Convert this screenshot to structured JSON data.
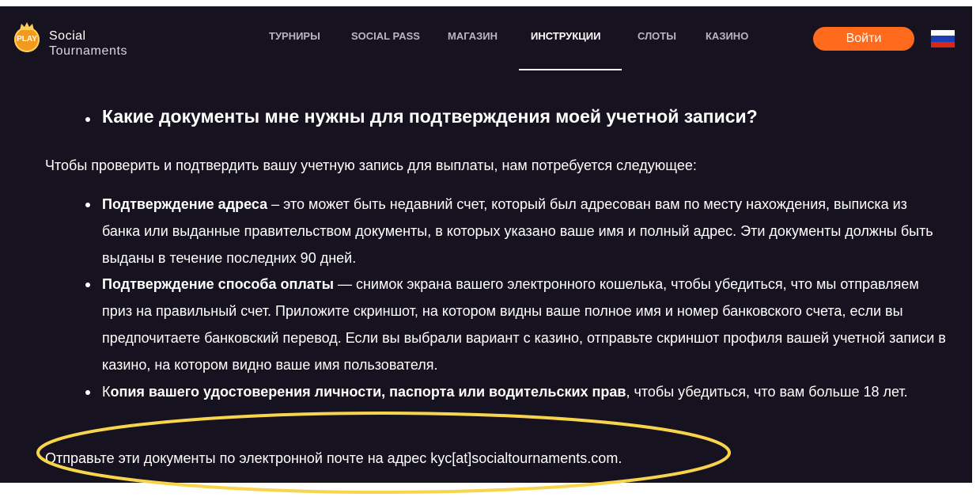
{
  "header": {
    "logo": {
      "badge": "PLAY",
      "line1": "Social",
      "line2": "Tournaments"
    },
    "nav": [
      {
        "label": "ТУРНИРЫ",
        "active": false
      },
      {
        "label": "SOCIAL PASS",
        "active": false
      },
      {
        "label": "МАГАЗИН",
        "active": false
      },
      {
        "label": "ИНСТРУКЦИИ",
        "active": true
      },
      {
        "label": "СЛОТЫ",
        "active": false
      },
      {
        "label": "КАЗИНО",
        "active": false
      }
    ],
    "login_label": "Войти",
    "language_flag_icon": "russia-flag-icon"
  },
  "content": {
    "heading": "Какие документы мне нужны для подтверждения моей учетной записи?",
    "intro": "Чтобы проверить и подтвердить вашу учетную запись для выплаты, нам потребуется следующее:",
    "items": [
      {
        "bold": "Подтверждение адреса",
        "text": " – это может быть недавний счет, который был адресован вам по месту нахождения, выписка из банка или выданные правительством документы, в которых указано ваше имя и полный адрес. Эти документы должны быть выданы в течение последних 90 дней."
      },
      {
        "bold": "Подтверждение способа оплаты",
        "text": " — снимок экрана вашего электронного кошелька, чтобы убедиться, что мы отправляем приз на правильный счет. Приложите скриншот, на котором видны ваше полное имя и номер банковского счета, если вы предпочитаете банковский перевод. Если вы выбрали вариант с казино, отправьте скриншот профиля вашей учетной записи в казино, на котором видно ваше имя пользователя."
      },
      {
        "prefix": "К",
        "bold": "опия вашего удостоверения личности, паспорта или водительских прав",
        "text": ", чтобы убедиться, что вам больше 18 лет."
      }
    ],
    "footer": "Отправьте эти документы по электронной почте на адрес kyc[at]socialtournaments.com."
  },
  "colors": {
    "background": "#16121f",
    "accent": "#ff6a1d",
    "highlight": "#f7d44c",
    "text": "#ffffff",
    "nav_inactive": "#b8b5c2"
  }
}
